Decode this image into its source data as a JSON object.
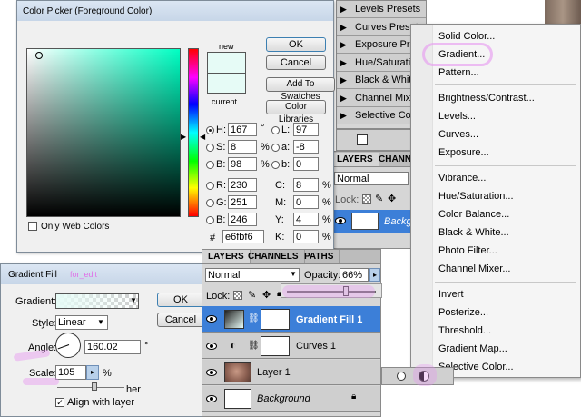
{
  "color_picker": {
    "title": "Color Picker (Foreground Color)",
    "new_label": "new",
    "current_label": "current",
    "buttons": {
      "ok": "OK",
      "cancel": "Cancel",
      "add_to_swatches": "Add To Swatches",
      "color_libraries": "Color Libraries"
    },
    "only_web_colors": "Only Web Colors",
    "hsb": {
      "h_label": "H:",
      "h": "167",
      "h_unit": "°",
      "s_label": "S:",
      "s": "8",
      "s_unit": "%",
      "b_label": "B:",
      "b": "98",
      "b_unit": "%"
    },
    "rgb": {
      "r_label": "R:",
      "r": "230",
      "g_label": "G:",
      "g": "251",
      "b_label": "B:",
      "b": "246"
    },
    "lab": {
      "l_label": "L:",
      "l": "97",
      "a_label": "a:",
      "a": "-8",
      "b_label": "b:",
      "b": "0"
    },
    "cmyk": {
      "c_label": "C:",
      "c": "8",
      "m_label": "M:",
      "m": "0",
      "y_label": "Y:",
      "y": "4",
      "k_label": "K:",
      "k": "0",
      "unit": "%"
    },
    "hex_label": "#",
    "hex": "e6fbf6",
    "new_color": "#e6fbf6",
    "current_color": "#e6fbf6"
  },
  "gradient_fill": {
    "title": "Gradient Fill",
    "title_suffix": "for_edit",
    "gradient_label": "Gradient:",
    "style_label": "Style:",
    "style_value": "Linear",
    "angle_label": "Angle:",
    "angle_value": "160.02",
    "angle_unit": "°",
    "scale_label": "Scale:",
    "scale_value": "105",
    "scale_unit": "%",
    "reverse_fragment": "her",
    "align_label": "Align with layer",
    "buttons": {
      "ok": "OK",
      "cancel": "Cancel"
    }
  },
  "presets_panel": {
    "items": [
      "Levels Presets",
      "Curves Presets",
      "Exposure Prese",
      "Hue/Saturation",
      "Black & White",
      "Channel Mixer",
      "Selective Colo"
    ]
  },
  "layers_back": {
    "tabs": [
      "LAYERS",
      "CHANN"
    ],
    "blend_mode": "Normal",
    "lock_label": "Lock:",
    "layer_name": "Backg"
  },
  "layers_panel": {
    "tabs": [
      "LAYERS",
      "CHANNELS",
      "PATHS"
    ],
    "blend_mode": "Normal",
    "opacity_label": "Opacity:",
    "opacity_value": "66%",
    "opacity": 66,
    "lock_label": "Lock:",
    "layers": [
      {
        "name": "Gradient Fill 1"
      },
      {
        "name": "Curves 1"
      },
      {
        "name": "Layer 1"
      },
      {
        "name": "Background"
      }
    ]
  },
  "adjustment_menu": {
    "group1": [
      "Solid Color...",
      "Gradient...",
      "Pattern..."
    ],
    "group2": [
      "Brightness/Contrast...",
      "Levels...",
      "Curves...",
      "Exposure..."
    ],
    "group3": [
      "Vibrance...",
      "Hue/Saturation...",
      "Color Balance...",
      "Black & White...",
      "Photo Filter...",
      "Channel Mixer..."
    ],
    "group4": [
      "Invert",
      "Posterize...",
      "Threshold...",
      "Gradient Map...",
      "Selective Color..."
    ]
  },
  "colors": {
    "selection_blue": "#3c7fd8",
    "annotation_pink": "#e896f0",
    "dialog_bg": "#f0f0f0",
    "panel_bg": "#d6d6d6"
  }
}
